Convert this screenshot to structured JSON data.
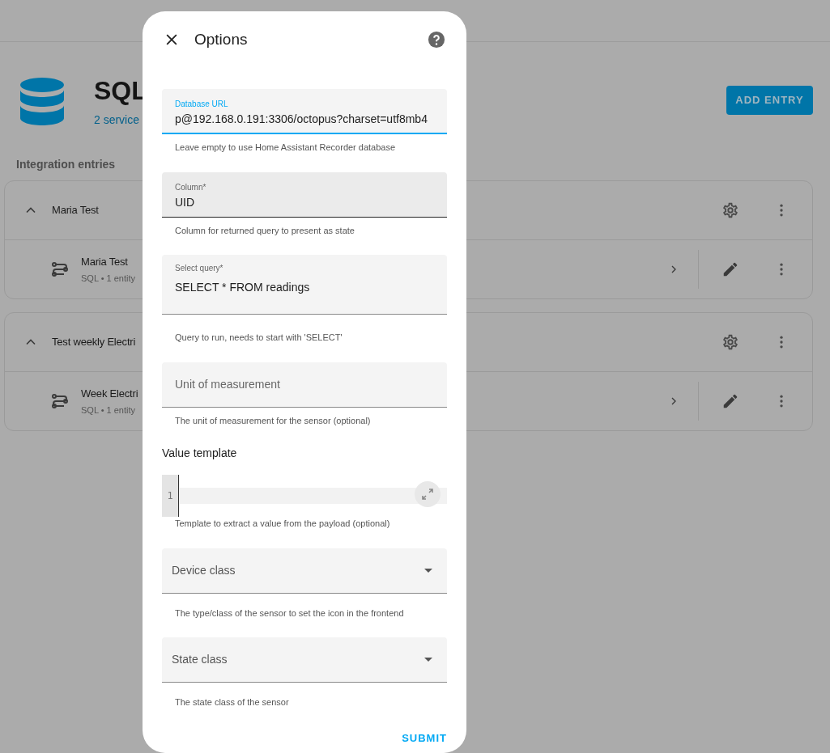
{
  "page": {
    "title": "SQL",
    "subtitle": "2 service",
    "add_button": "ADD ENTRY",
    "section_title": "Integration entries",
    "entries": [
      {
        "title": "Maria Test",
        "expanded": true,
        "children": [
          {
            "title": "Maria Test",
            "subtitle": "SQL • 1 entity"
          }
        ]
      },
      {
        "title": "Test weekly Electri",
        "expanded": true,
        "children": [
          {
            "title": "Week Electri",
            "subtitle": "SQL • 1 entity"
          }
        ]
      }
    ]
  },
  "dialog": {
    "title": "Options",
    "submit": "SUBMIT",
    "fields": [
      {
        "kind": "text",
        "label": "Database URL",
        "value": "p@192.168.0.191:3306/octopus?charset=utf8mb4",
        "focused": true,
        "hovered": false,
        "helper": "Leave empty to use Home Assistant Recorder database"
      },
      {
        "kind": "text",
        "label": "Column*",
        "value": "UID",
        "focused": false,
        "hovered": true,
        "helper": "Column for returned query to present as state"
      },
      {
        "kind": "textarea",
        "label": "Select query*",
        "value": "SELECT * FROM readings",
        "focused": false,
        "hovered": false,
        "helper": "Query to run, needs to start with 'SELECT'"
      },
      {
        "kind": "text",
        "label": "Unit of measurement",
        "focused": false,
        "hovered": false,
        "helper": "The unit of measurement for the sensor (optional)"
      },
      {
        "kind": "code",
        "heading": "Value template",
        "line_numbers": [
          "1"
        ],
        "helper": "Template to extract a value from the payload (optional)"
      },
      {
        "kind": "select",
        "label": "Device class",
        "helper": "The type/class of the sensor to set the icon in the frontend"
      },
      {
        "kind": "select",
        "label": "State class",
        "helper": "The state class of the sensor"
      }
    ]
  }
}
